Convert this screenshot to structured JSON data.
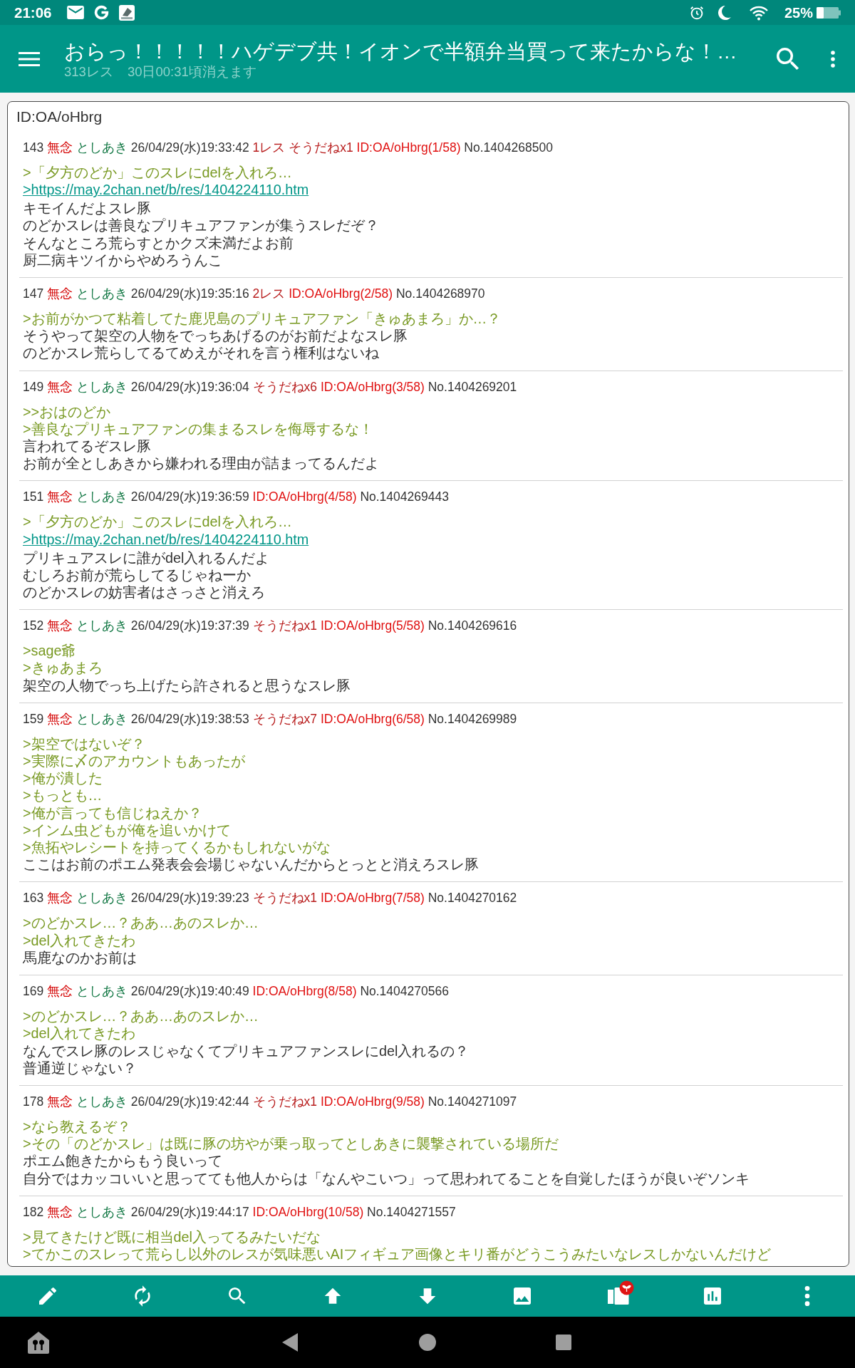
{
  "status_bar": {
    "time": "21:06",
    "battery": "25%"
  },
  "app_bar": {
    "title": "おらっ！！！！！ハゲデブ共！イオンで半額弁当買って来たからな！…",
    "res_count": "313レス",
    "expires": "30日00:31頃消えます"
  },
  "popup": {
    "title": "ID:OA/oHbrg",
    "posts": [
      {
        "number": "143",
        "subject": "無念",
        "name": "としあき",
        "datetime": "26/04/29(水)19:33:42",
        "replies": "1レス",
        "sodane": "そうだねx1",
        "id": "ID:OA/oHbrg(1/58)",
        "no": "No.1404268500",
        "lines": [
          {
            "kind": "quote",
            "text": ">「夕方のどか」このスレにdelを入れろ…"
          },
          {
            "kind": "link",
            "text": ">https://may.2chan.net/b/res/1404224110.htm"
          },
          {
            "kind": "text",
            "text": "キモイんだよスレ豚"
          },
          {
            "kind": "text",
            "text": "のどかスレは善良なプリキュアファンが集うスレだぞ？"
          },
          {
            "kind": "text",
            "text": "そんなところ荒らすとかクズ未満だよお前"
          },
          {
            "kind": "text",
            "text": "厨二病キツイからやめろうんこ"
          }
        ]
      },
      {
        "number": "147",
        "subject": "無念",
        "name": "としあき",
        "datetime": "26/04/29(水)19:35:16",
        "replies": "2レス",
        "id": "ID:OA/oHbrg(2/58)",
        "no": "No.1404268970",
        "lines": [
          {
            "kind": "quote",
            "text": ">お前がかつて粘着してた鹿児島のプリキュアファン「きゅあまろ」か…？"
          },
          {
            "kind": "text",
            "text": "そうやって架空の人物をでっちあげるのがお前だよなスレ豚"
          },
          {
            "kind": "text",
            "text": "のどかスレ荒らしてるてめえがそれを言う権利はないね"
          }
        ]
      },
      {
        "number": "149",
        "subject": "無念",
        "name": "としあき",
        "datetime": "26/04/29(水)19:36:04",
        "sodane": "そうだねx6",
        "id": "ID:OA/oHbrg(3/58)",
        "no": "No.1404269201",
        "lines": [
          {
            "kind": "quote",
            "text": ">>おはのどか"
          },
          {
            "kind": "quote",
            "text": ">善良なプリキュアファンの集まるスレを侮辱するな！"
          },
          {
            "kind": "text",
            "text": "言われてるぞスレ豚"
          },
          {
            "kind": "text",
            "text": "お前が全としあきから嫌われる理由が詰まってるんだよ"
          }
        ]
      },
      {
        "number": "151",
        "subject": "無念",
        "name": "としあき",
        "datetime": "26/04/29(水)19:36:59",
        "id": "ID:OA/oHbrg(4/58)",
        "no": "No.1404269443",
        "lines": [
          {
            "kind": "quote",
            "text": ">「夕方のどか」このスレにdelを入れろ…"
          },
          {
            "kind": "link",
            "text": ">https://may.2chan.net/b/res/1404224110.htm"
          },
          {
            "kind": "text",
            "text": "プリキュアスレに誰がdel入れるんだよ"
          },
          {
            "kind": "text",
            "text": "むしろお前が荒らしてるじゃねーか"
          },
          {
            "kind": "text",
            "text": "のどかスレの妨害者はさっさと消えろ"
          }
        ]
      },
      {
        "number": "152",
        "subject": "無念",
        "name": "としあき",
        "datetime": "26/04/29(水)19:37:39",
        "sodane": "そうだねx1",
        "id": "ID:OA/oHbrg(5/58)",
        "no": "No.1404269616",
        "lines": [
          {
            "kind": "quote",
            "text": ">sage爺"
          },
          {
            "kind": "quote",
            "text": ">きゅあまろ"
          },
          {
            "kind": "text",
            "text": "架空の人物でっち上げたら許されると思うなスレ豚"
          }
        ]
      },
      {
        "number": "159",
        "subject": "無念",
        "name": "としあき",
        "datetime": "26/04/29(水)19:38:53",
        "sodane": "そうだねx7",
        "id": "ID:OA/oHbrg(6/58)",
        "no": "No.1404269989",
        "lines": [
          {
            "kind": "quote",
            "text": ">架空ではないぞ？"
          },
          {
            "kind": "quote",
            "text": ">実際に〆のアカウントもあったが"
          },
          {
            "kind": "quote",
            "text": ">俺が潰した"
          },
          {
            "kind": "quote",
            "text": ">もっとも…"
          },
          {
            "kind": "quote",
            "text": ">俺が言っても信じねえか？"
          },
          {
            "kind": "quote",
            "text": ">インム虫どもが俺を追いかけて"
          },
          {
            "kind": "quote",
            "text": ">魚拓やレシートを持ってくるかもしれないがな"
          },
          {
            "kind": "text",
            "text": "ここはお前のポエム発表会会場じゃないんだからとっとと消えろスレ豚"
          }
        ]
      },
      {
        "number": "163",
        "subject": "無念",
        "name": "としあき",
        "datetime": "26/04/29(水)19:39:23",
        "sodane": "そうだねx1",
        "id": "ID:OA/oHbrg(7/58)",
        "no": "No.1404270162",
        "lines": [
          {
            "kind": "quote",
            "text": ">のどかスレ…？ああ…あのスレか…"
          },
          {
            "kind": "quote",
            "text": ">del入れてきたわ"
          },
          {
            "kind": "text",
            "text": "馬鹿なのかお前は"
          }
        ]
      },
      {
        "number": "169",
        "subject": "無念",
        "name": "としあき",
        "datetime": "26/04/29(水)19:40:49",
        "id": "ID:OA/oHbrg(8/58)",
        "no": "No.1404270566",
        "lines": [
          {
            "kind": "quote",
            "text": ">のどかスレ…？ああ…あのスレか…"
          },
          {
            "kind": "quote",
            "text": ">del入れてきたわ"
          },
          {
            "kind": "text",
            "text": "なんでスレ豚のレスじゃなくてプリキュアファンスレにdel入れるの？"
          },
          {
            "kind": "text",
            "text": "普通逆じゃない？"
          }
        ]
      },
      {
        "number": "178",
        "subject": "無念",
        "name": "としあき",
        "datetime": "26/04/29(水)19:42:44",
        "sodane": "そうだねx1",
        "id": "ID:OA/oHbrg(9/58)",
        "no": "No.1404271097",
        "lines": [
          {
            "kind": "quote",
            "text": ">なら教えるぞ？"
          },
          {
            "kind": "quote",
            "text": ">その「のどかスレ」は既に豚の坊やが乗っ取ってとしあきに襲撃されている場所だ"
          },
          {
            "kind": "text",
            "text": "ポエム飽きたからもう良いって"
          },
          {
            "kind": "text",
            "text": "自分ではカッコいいと思ってても他人からは「なんやこいつ」って思われてることを自覚したほうが良いぞソンキ"
          }
        ]
      },
      {
        "number": "182",
        "subject": "無念",
        "name": "としあき",
        "datetime": "26/04/29(水)19:44:17",
        "id": "ID:OA/oHbrg(10/58)",
        "no": "No.1404271557",
        "lines": [
          {
            "kind": "quote",
            "text": ">見てきたけど既に相当del入ってるみたいだな"
          },
          {
            "kind": "quote",
            "text": ">てかこのスレって荒らし以外のレスが気味悪いAIフィギュア画像とキリ番がどうこうみたいなレスしかないんだけど"
          }
        ]
      }
    ]
  }
}
